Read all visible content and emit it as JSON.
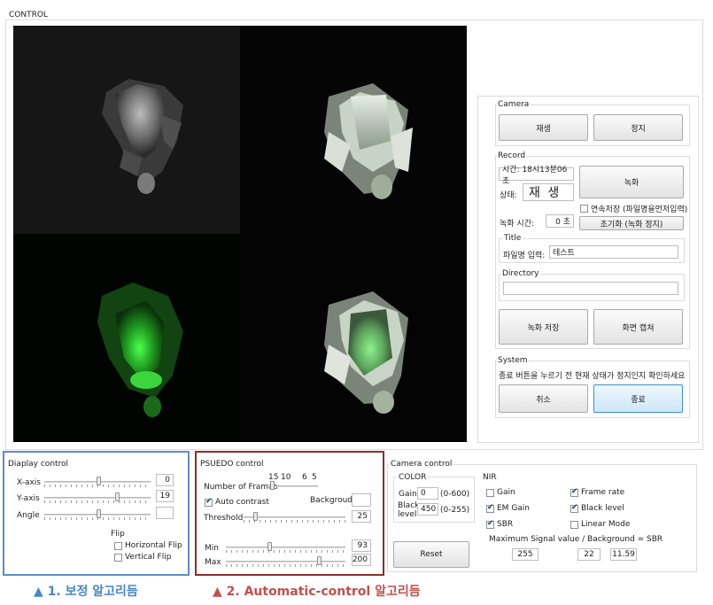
{
  "window": {
    "title": "CONTROL"
  },
  "camera": {
    "group_label": "Camera",
    "play_label": "재생",
    "stop_label": "정지"
  },
  "record": {
    "group_label": "Record",
    "time_text": "시간: 18시13분06초",
    "status_label": "상태:",
    "status_value": "재 생",
    "record_button": "녹화",
    "continuous_save_label": "연속저장 (파일명을먼저입력)",
    "duration_label": "녹화 시간:",
    "duration_value": "0 초",
    "reset_button": "초기화 (녹화 정지)",
    "title_group": "Title",
    "filename_label": "파일명 입력:",
    "filename_value": "테스트",
    "directory_group": "Directory",
    "directory_value": "",
    "save_record_button": "녹화 저장",
    "capture_button": "화면 캡쳐"
  },
  "system": {
    "group_label": "System",
    "message": "종료 버튼을 누르기 전 현재 상태가 정지인지 확인하세요",
    "cancel_button": "취소",
    "exit_button": "종료"
  },
  "display_control": {
    "group_label": "Diaplay control",
    "x_axis_label": "X-axis",
    "x_axis_value": "0",
    "x_axis_level": 0.5,
    "y_axis_label": "Y-axis",
    "y_axis_value": "19",
    "y_axis_level": 0.68,
    "angle_label": "Angle",
    "angle_value": "",
    "angle_level": 0.5,
    "flip_label": "Flip",
    "horizontal_flip_label": "Horizontal Flip",
    "vertical_flip_label": "Vertical Flip"
  },
  "pseudo_control": {
    "group_label": "PSUEDO control",
    "frames_scale": [
      "15",
      "10",
      "6",
      "5"
    ],
    "frames_label": "Number of Frames",
    "auto_contrast_label": "Auto contrast",
    "background_label": "Backgroud :",
    "background_value": "",
    "threshold_label": "Threshold",
    "threshold_value": "25",
    "threshold_level": 0.1,
    "min_label": "Min",
    "min_value": "93",
    "min_level": 0.36,
    "max_label": "Max",
    "max_value": "200",
    "max_level": 0.78
  },
  "camera_control": {
    "group_label": "Camera control",
    "color_group": "COLOR",
    "gain_label": "Gain",
    "gain_value": "0",
    "gain_range": "(0-600)",
    "black_level_label": "Black level",
    "black_level_value": "450",
    "black_level_range": "(0-255)",
    "reset_button": "Reset",
    "nir_group": "NIR",
    "nir_gain_label": "Gain",
    "em_gain_label": "EM Gain",
    "sbr_label": "SBR",
    "frame_rate_label": "Frame rate",
    "black_level_chk_label": "Black level",
    "linear_mode_label": "Linear Mode",
    "sbr_formula": "Maximum Signal value / Background  = SBR",
    "max_signal_value": "255",
    "background_value": "22",
    "sbr_value": "11.59"
  },
  "captions": {
    "first": "▲ 1. 보정 알고리듬",
    "second": "▲ 2. Automatic-control 알고리듬"
  },
  "colors": {
    "caption_blue": "#4a86c5",
    "caption_red": "#c0504d",
    "highlight_blue": "#5b8ec4",
    "highlight_red": "#8b2e2a",
    "accent_button": "#3c8fcb"
  }
}
